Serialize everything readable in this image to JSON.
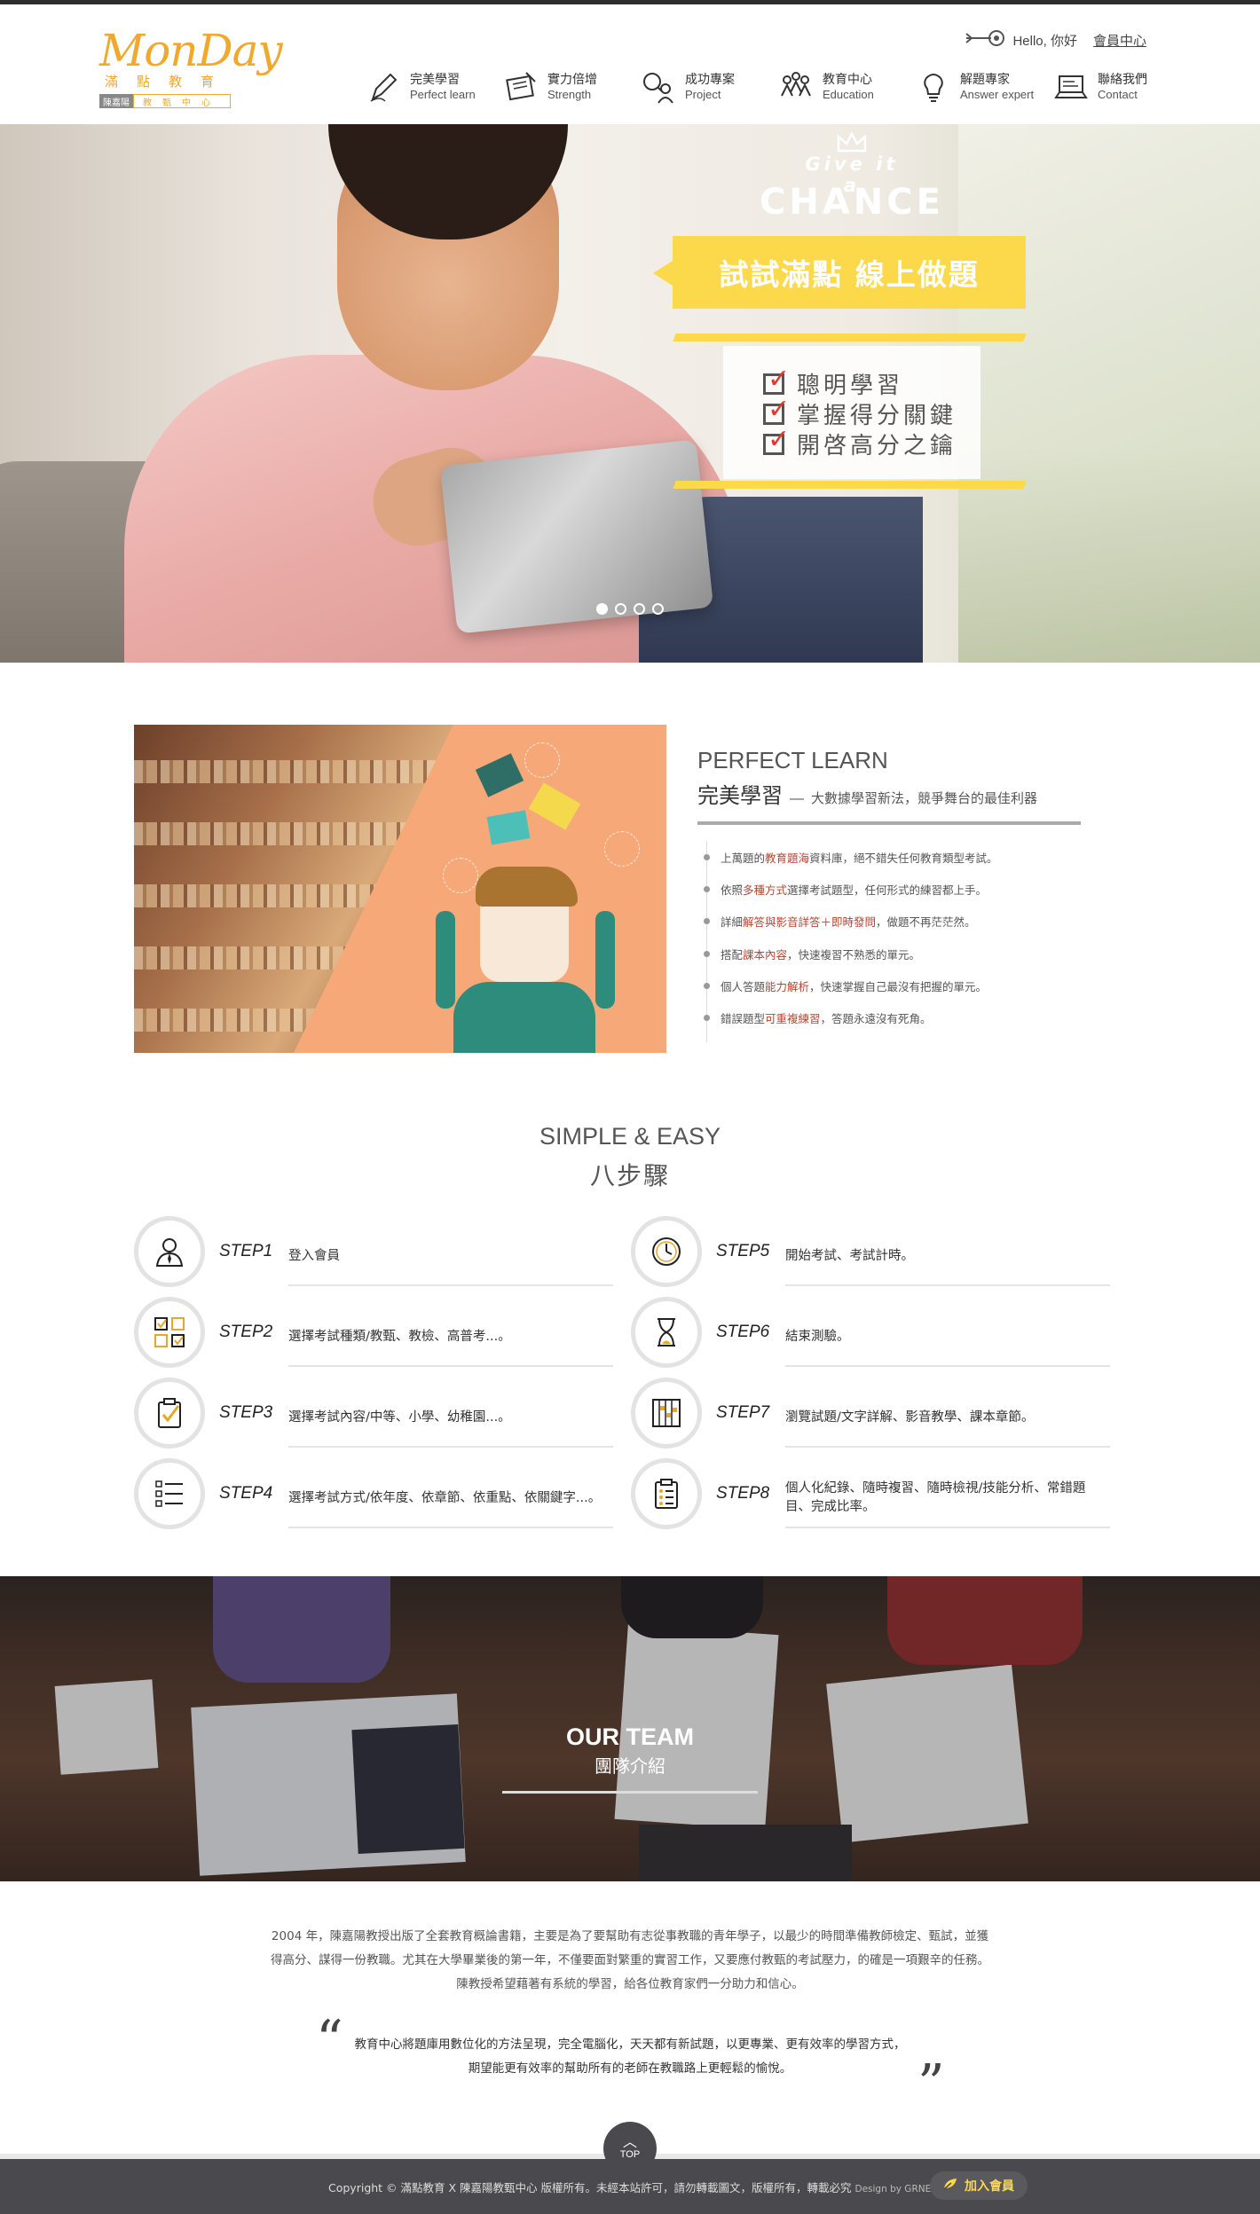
{
  "logo": {
    "word": "MonDay",
    "cn": "滿點教育",
    "tag": "陳嘉陽",
    "tag2": "教甄中心"
  },
  "topbar": {
    "greeting": "Hello, 你好",
    "member_center": "會員中心"
  },
  "nav": [
    {
      "cn": "完美學習",
      "en": "Perfect learn",
      "icon": "pen-icon"
    },
    {
      "cn": "實力倍增",
      "en": "Strength",
      "icon": "notebook-icon"
    },
    {
      "cn": "成功專案",
      "en": "Project",
      "icon": "magnifier-person-icon"
    },
    {
      "cn": "教育中心",
      "en": "Education",
      "icon": "group-icon"
    },
    {
      "cn": "解題專家",
      "en": "Answer expert",
      "icon": "lightbulb-icon"
    },
    {
      "cn": "聯絡我們",
      "en": "Contact",
      "icon": "laptop-icon"
    }
  ],
  "hero": {
    "give": "Give it a",
    "chance": "CHANCE",
    "banner": "試試滿點 線上做題",
    "checks": [
      "聰明學習",
      "掌握得分關鍵",
      "開啓高分之鑰"
    ],
    "slides": 4,
    "active_slide": 1
  },
  "perfect_learn": {
    "title": "PERFECT LEARN",
    "cn": "完美學習",
    "dash": "—",
    "desc": "大數據學習新法，競爭舞台的最佳利器",
    "items": [
      {
        "pre": "上萬題的",
        "hl": "教育題海",
        "post": "資料庫，絕不錯失任何教育類型考試。"
      },
      {
        "pre": "依照",
        "hl": "多種方式",
        "post": "選擇考試題型，任何形式的練習都上手。"
      },
      {
        "pre": "詳細",
        "hl": "解答與影音詳答＋即時發問",
        "post": "，做題不再茫茫然。"
      },
      {
        "pre": "搭配",
        "hl": "課本內容",
        "post": "，快速複習不熟悉的單元。"
      },
      {
        "pre": "個人答題",
        "hl": "能力解析",
        "post": "，快速掌握自己最沒有把握的單元。"
      },
      {
        "pre": "錯誤題型",
        "hl": "可重複練習",
        "post": "，答題永遠沒有死角。"
      }
    ]
  },
  "steps_section": {
    "title": "SIMPLE & EASY",
    "sub": "八步驟",
    "steps": [
      {
        "label": "STEP1",
        "desc": "登入會員",
        "icon": "user-icon"
      },
      {
        "label": "STEP2",
        "desc": "選擇考試種類/教甄、教檢、高普考...。",
        "icon": "checkbox-grid-icon"
      },
      {
        "label": "STEP3",
        "desc": "選擇考試內容/中等、小學、幼稚園...。",
        "icon": "clipboard-check-icon"
      },
      {
        "label": "STEP4",
        "desc": "選擇考試方式/依年度、依章節、依重點、依關鍵字...。",
        "icon": "list-icon"
      },
      {
        "label": "STEP5",
        "desc": "開始考試、考試計時。",
        "icon": "clock-icon"
      },
      {
        "label": "STEP6",
        "desc": "結束測驗。",
        "icon": "hourglass-icon"
      },
      {
        "label": "STEP7",
        "desc": "瀏覽試題/文字詳解、影音教學、課本章節。",
        "icon": "answer-sheet-icon"
      },
      {
        "label": "STEP8",
        "desc": "個人化紀錄、隨時複習、隨時檢視/技能分析、常錯題目、完成比率。",
        "icon": "report-icon"
      }
    ]
  },
  "team": {
    "title": "OUR TEAM",
    "sub": "團隊介紹"
  },
  "about": {
    "line1": "2004 年，陳嘉陽教授出版了全套教育概論書籍，主要是為了要幫助有志從事教職的青年學子，以最少的時間準備教師檢定、甄試，並獲",
    "line2": "得高分、謀得一份教職。尤其在大學畢業後的第一年，不僅要面對繁重的實習工作，又要應付教甄的考試壓力，的確是一項艱辛的任務。",
    "line3": "陳教授希望藉著有系統的學習，給各位教育家們一分助力和信心。"
  },
  "quote": {
    "line1": "教育中心將題庫用數位化的方法呈現，完全電腦化，天天都有新試題，以更專業、更有效率的學習方式，",
    "line2": "期望能更有效率的幫助所有的老師在教職路上更輕鬆的愉悅。"
  },
  "footer": {
    "copyright": "Copyright © 滿點教育 X 陳嘉陽教甄中心 版權所有。未經本站許可，請勿轉載圖文，版權所有，轉載必究",
    "design": "Design by GRNET.",
    "join": "加入會員",
    "top": "TOP"
  }
}
